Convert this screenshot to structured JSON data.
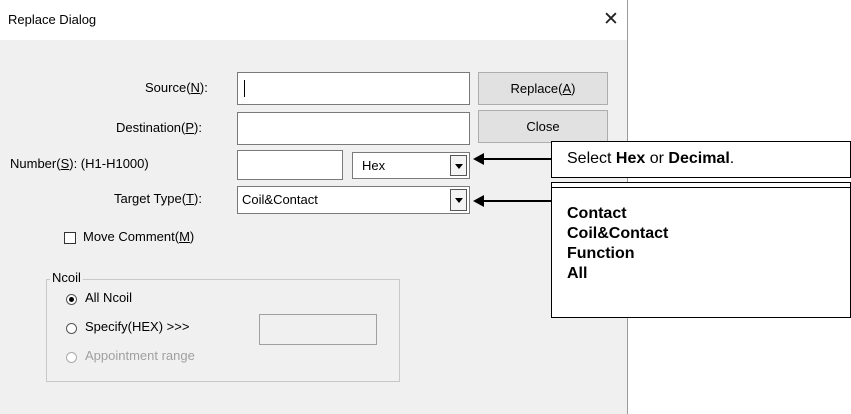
{
  "window": {
    "title": "Replace Dialog",
    "close_glyph": "✕"
  },
  "form": {
    "source": {
      "label": "Source(",
      "key": "N",
      "tail": "):",
      "value": ""
    },
    "destination": {
      "label": "Destination(",
      "key": "P",
      "tail": "):",
      "value": ""
    },
    "number": {
      "label": "Number(",
      "key": "S",
      "tail": "): (H1-H1000)",
      "value": "",
      "format_value": "Hex"
    },
    "target_type": {
      "label": "Target Type(",
      "key": "T",
      "tail": "):",
      "value": "Coil&Contact"
    },
    "move_comment": {
      "label": "Move Comment(",
      "key": "M",
      "tail": ")",
      "checked": false
    }
  },
  "buttons": {
    "replace": {
      "label": "Replace(",
      "key": "A",
      "tail": ")"
    },
    "close": {
      "label": "Close"
    }
  },
  "ncoil": {
    "title": "Ncoil",
    "all": {
      "label": "All Ncoil",
      "selected": true
    },
    "specify": {
      "label": "Specify(HEX) >>>",
      "selected": false,
      "value": ""
    },
    "range": {
      "label": "Appointment range",
      "selected": false,
      "enabled": false
    }
  },
  "callouts": {
    "format": {
      "pre": "Select ",
      "b1": "Hex",
      "mid": " or ",
      "b2": "Decimal",
      "post": "."
    },
    "types": [
      "Contact",
      "Coil&Contact",
      "Function",
      "All"
    ]
  }
}
